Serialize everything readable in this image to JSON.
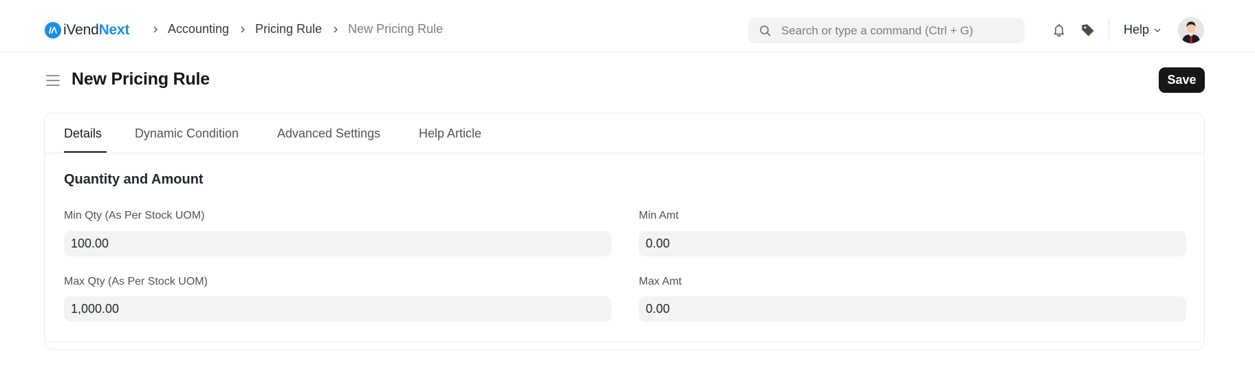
{
  "app": {
    "brand_prefix": "iVend",
    "brand_accent": "Next",
    "brand_color": "#1a8fe3"
  },
  "breadcrumbs": [
    {
      "label": "Accounting"
    },
    {
      "label": "Pricing Rule"
    },
    {
      "label": "New Pricing Rule"
    }
  ],
  "search": {
    "placeholder": "Search or type a command (Ctrl + G)",
    "value": ""
  },
  "navbar": {
    "notifications_icon": "bell-icon",
    "tags_icon": "tag-icon",
    "help_label": "Help",
    "avatar_icon": "user-avatar"
  },
  "page": {
    "title": "New Pricing Rule",
    "save_label": "Save",
    "menu_icon": "hamburger-icon"
  },
  "tabs": [
    {
      "label": "Details",
      "active": true
    },
    {
      "label": "Dynamic Condition",
      "active": false
    },
    {
      "label": "Advanced Settings",
      "active": false
    },
    {
      "label": "Help Article",
      "active": false
    }
  ],
  "section": {
    "title": "Quantity and Amount",
    "fields": {
      "min_qty": {
        "label": "Min Qty (As Per Stock UOM)",
        "value": "100.00"
      },
      "max_qty": {
        "label": "Max Qty (As Per Stock UOM)",
        "value": "1,000.00"
      },
      "min_amt": {
        "label": "Min Amt",
        "value": "0.00"
      },
      "max_amt": {
        "label": "Max Amt",
        "value": "0.00"
      }
    }
  }
}
